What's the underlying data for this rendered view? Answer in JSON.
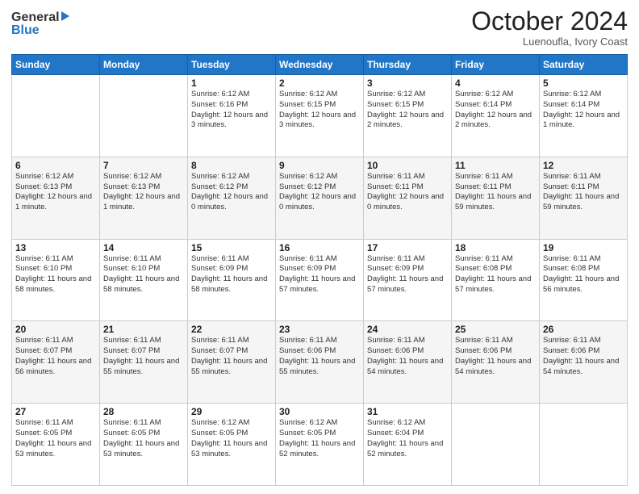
{
  "header": {
    "logo_line1": "General",
    "logo_line2": "Blue",
    "month_title": "October 2024",
    "location": "Luenoufla, Ivory Coast"
  },
  "days_of_week": [
    "Sunday",
    "Monday",
    "Tuesday",
    "Wednesday",
    "Thursday",
    "Friday",
    "Saturday"
  ],
  "weeks": [
    [
      {
        "day": "",
        "sunrise": "",
        "sunset": "",
        "daylight": ""
      },
      {
        "day": "",
        "sunrise": "",
        "sunset": "",
        "daylight": ""
      },
      {
        "day": "1",
        "sunrise": "Sunrise: 6:12 AM",
        "sunset": "Sunset: 6:16 PM",
        "daylight": "Daylight: 12 hours and 3 minutes."
      },
      {
        "day": "2",
        "sunrise": "Sunrise: 6:12 AM",
        "sunset": "Sunset: 6:15 PM",
        "daylight": "Daylight: 12 hours and 3 minutes."
      },
      {
        "day": "3",
        "sunrise": "Sunrise: 6:12 AM",
        "sunset": "Sunset: 6:15 PM",
        "daylight": "Daylight: 12 hours and 2 minutes."
      },
      {
        "day": "4",
        "sunrise": "Sunrise: 6:12 AM",
        "sunset": "Sunset: 6:14 PM",
        "daylight": "Daylight: 12 hours and 2 minutes."
      },
      {
        "day": "5",
        "sunrise": "Sunrise: 6:12 AM",
        "sunset": "Sunset: 6:14 PM",
        "daylight": "Daylight: 12 hours and 1 minute."
      }
    ],
    [
      {
        "day": "6",
        "sunrise": "Sunrise: 6:12 AM",
        "sunset": "Sunset: 6:13 PM",
        "daylight": "Daylight: 12 hours and 1 minute."
      },
      {
        "day": "7",
        "sunrise": "Sunrise: 6:12 AM",
        "sunset": "Sunset: 6:13 PM",
        "daylight": "Daylight: 12 hours and 1 minute."
      },
      {
        "day": "8",
        "sunrise": "Sunrise: 6:12 AM",
        "sunset": "Sunset: 6:12 PM",
        "daylight": "Daylight: 12 hours and 0 minutes."
      },
      {
        "day": "9",
        "sunrise": "Sunrise: 6:12 AM",
        "sunset": "Sunset: 6:12 PM",
        "daylight": "Daylight: 12 hours and 0 minutes."
      },
      {
        "day": "10",
        "sunrise": "Sunrise: 6:11 AM",
        "sunset": "Sunset: 6:11 PM",
        "daylight": "Daylight: 12 hours and 0 minutes."
      },
      {
        "day": "11",
        "sunrise": "Sunrise: 6:11 AM",
        "sunset": "Sunset: 6:11 PM",
        "daylight": "Daylight: 11 hours and 59 minutes."
      },
      {
        "day": "12",
        "sunrise": "Sunrise: 6:11 AM",
        "sunset": "Sunset: 6:11 PM",
        "daylight": "Daylight: 11 hours and 59 minutes."
      }
    ],
    [
      {
        "day": "13",
        "sunrise": "Sunrise: 6:11 AM",
        "sunset": "Sunset: 6:10 PM",
        "daylight": "Daylight: 11 hours and 58 minutes."
      },
      {
        "day": "14",
        "sunrise": "Sunrise: 6:11 AM",
        "sunset": "Sunset: 6:10 PM",
        "daylight": "Daylight: 11 hours and 58 minutes."
      },
      {
        "day": "15",
        "sunrise": "Sunrise: 6:11 AM",
        "sunset": "Sunset: 6:09 PM",
        "daylight": "Daylight: 11 hours and 58 minutes."
      },
      {
        "day": "16",
        "sunrise": "Sunrise: 6:11 AM",
        "sunset": "Sunset: 6:09 PM",
        "daylight": "Daylight: 11 hours and 57 minutes."
      },
      {
        "day": "17",
        "sunrise": "Sunrise: 6:11 AM",
        "sunset": "Sunset: 6:09 PM",
        "daylight": "Daylight: 11 hours and 57 minutes."
      },
      {
        "day": "18",
        "sunrise": "Sunrise: 6:11 AM",
        "sunset": "Sunset: 6:08 PM",
        "daylight": "Daylight: 11 hours and 57 minutes."
      },
      {
        "day": "19",
        "sunrise": "Sunrise: 6:11 AM",
        "sunset": "Sunset: 6:08 PM",
        "daylight": "Daylight: 11 hours and 56 minutes."
      }
    ],
    [
      {
        "day": "20",
        "sunrise": "Sunrise: 6:11 AM",
        "sunset": "Sunset: 6:07 PM",
        "daylight": "Daylight: 11 hours and 56 minutes."
      },
      {
        "day": "21",
        "sunrise": "Sunrise: 6:11 AM",
        "sunset": "Sunset: 6:07 PM",
        "daylight": "Daylight: 11 hours and 55 minutes."
      },
      {
        "day": "22",
        "sunrise": "Sunrise: 6:11 AM",
        "sunset": "Sunset: 6:07 PM",
        "daylight": "Daylight: 11 hours and 55 minutes."
      },
      {
        "day": "23",
        "sunrise": "Sunrise: 6:11 AM",
        "sunset": "Sunset: 6:06 PM",
        "daylight": "Daylight: 11 hours and 55 minutes."
      },
      {
        "day": "24",
        "sunrise": "Sunrise: 6:11 AM",
        "sunset": "Sunset: 6:06 PM",
        "daylight": "Daylight: 11 hours and 54 minutes."
      },
      {
        "day": "25",
        "sunrise": "Sunrise: 6:11 AM",
        "sunset": "Sunset: 6:06 PM",
        "daylight": "Daylight: 11 hours and 54 minutes."
      },
      {
        "day": "26",
        "sunrise": "Sunrise: 6:11 AM",
        "sunset": "Sunset: 6:06 PM",
        "daylight": "Daylight: 11 hours and 54 minutes."
      }
    ],
    [
      {
        "day": "27",
        "sunrise": "Sunrise: 6:11 AM",
        "sunset": "Sunset: 6:05 PM",
        "daylight": "Daylight: 11 hours and 53 minutes."
      },
      {
        "day": "28",
        "sunrise": "Sunrise: 6:11 AM",
        "sunset": "Sunset: 6:05 PM",
        "daylight": "Daylight: 11 hours and 53 minutes."
      },
      {
        "day": "29",
        "sunrise": "Sunrise: 6:12 AM",
        "sunset": "Sunset: 6:05 PM",
        "daylight": "Daylight: 11 hours and 53 minutes."
      },
      {
        "day": "30",
        "sunrise": "Sunrise: 6:12 AM",
        "sunset": "Sunset: 6:05 PM",
        "daylight": "Daylight: 11 hours and 52 minutes."
      },
      {
        "day": "31",
        "sunrise": "Sunrise: 6:12 AM",
        "sunset": "Sunset: 6:04 PM",
        "daylight": "Daylight: 11 hours and 52 minutes."
      },
      {
        "day": "",
        "sunrise": "",
        "sunset": "",
        "daylight": ""
      },
      {
        "day": "",
        "sunrise": "",
        "sunset": "",
        "daylight": ""
      }
    ]
  ]
}
